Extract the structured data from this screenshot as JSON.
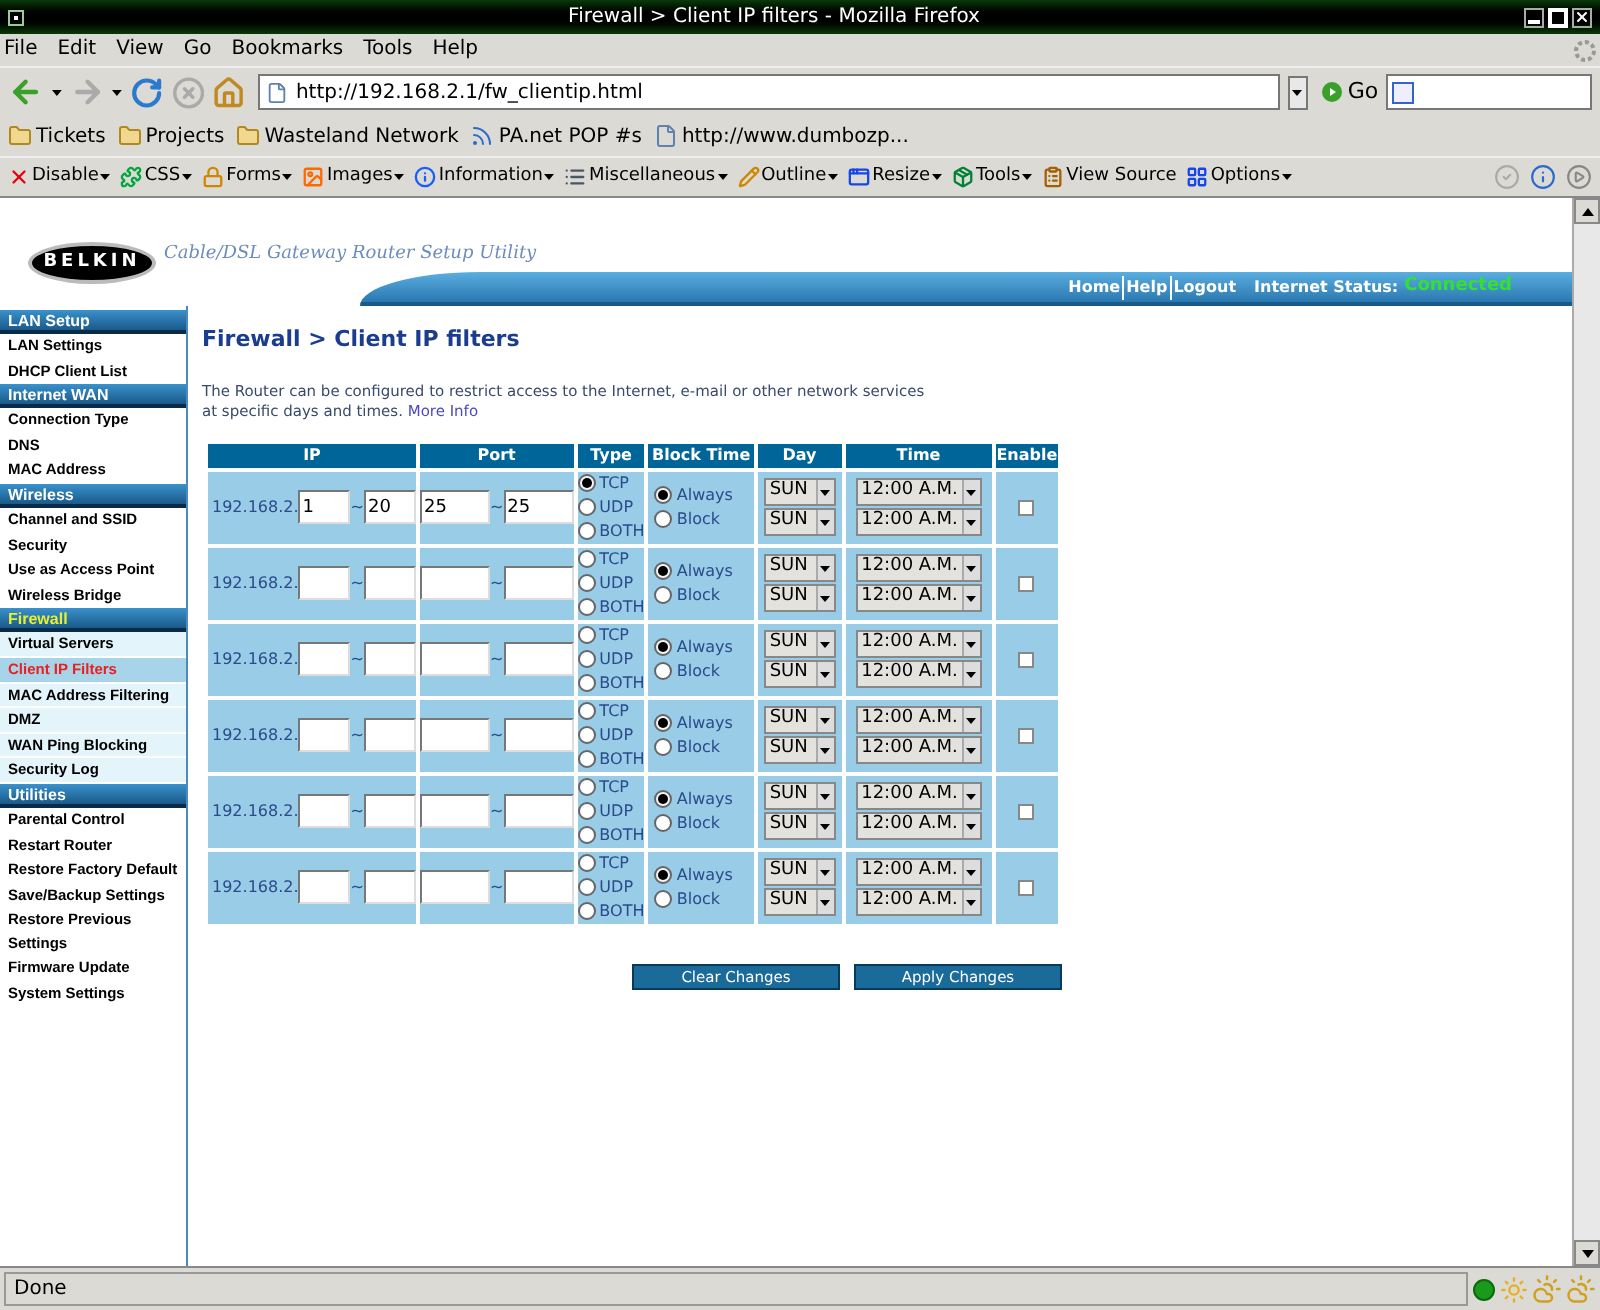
{
  "window": {
    "title": "Firewall > Client IP filters - Mozilla Firefox"
  },
  "menu": [
    "File",
    "Edit",
    "View",
    "Go",
    "Bookmarks",
    "Tools",
    "Help"
  ],
  "navigation": {
    "url": "http://192.168.2.1/fw_clientip.html",
    "go": "Go"
  },
  "bookmarks": [
    {
      "label": "Tickets",
      "kind": "folder"
    },
    {
      "label": "Projects",
      "kind": "folder"
    },
    {
      "label": "Wasteland Network",
      "kind": "folder"
    },
    {
      "label": "PA.net POP #s",
      "kind": "feed"
    },
    {
      "label": "http://www.dumbozp...",
      "kind": "page"
    }
  ],
  "dev_toolbar": [
    {
      "label": "Disable",
      "has_menu": true
    },
    {
      "label": "CSS",
      "has_menu": true
    },
    {
      "label": "Forms",
      "has_menu": true
    },
    {
      "label": "Images",
      "has_menu": true
    },
    {
      "label": "Information",
      "has_menu": true
    },
    {
      "label": "Miscellaneous",
      "has_menu": true
    },
    {
      "label": "Outline",
      "has_menu": true
    },
    {
      "label": "Resize",
      "has_menu": true
    },
    {
      "label": "Tools",
      "has_menu": true
    },
    {
      "label": "View Source",
      "has_menu": false
    },
    {
      "label": "Options",
      "has_menu": true
    }
  ],
  "page": {
    "logo": "BELKIN",
    "tagline": "Cable/DSL Gateway Router Setup Utility",
    "header_links": [
      "Home",
      "Help",
      "Logout"
    ],
    "status_label": "Internet Status:",
    "status_value": "Connected",
    "sidebar": [
      {
        "title": "LAN Setup",
        "selected": false,
        "items": [
          {
            "label": "LAN Settings",
            "selected": false
          },
          {
            "label": "DHCP Client List",
            "selected": false
          }
        ]
      },
      {
        "title": "Internet WAN",
        "selected": false,
        "items": [
          {
            "label": "Connection Type",
            "selected": false
          },
          {
            "label": "DNS",
            "selected": false
          },
          {
            "label": "MAC Address",
            "selected": false
          }
        ]
      },
      {
        "title": "Wireless",
        "selected": false,
        "items": [
          {
            "label": "Channel and SSID",
            "selected": false
          },
          {
            "label": "Security",
            "selected": false
          },
          {
            "label": "Use as Access Point",
            "selected": false
          },
          {
            "label": "Wireless Bridge",
            "selected": false
          }
        ]
      },
      {
        "title": "Firewall",
        "selected": true,
        "items": [
          {
            "label": "Virtual Servers",
            "selected": false
          },
          {
            "label": "Client IP Filters",
            "selected": true
          },
          {
            "label": "MAC Address Filtering",
            "selected": false
          },
          {
            "label": "DMZ",
            "selected": false
          },
          {
            "label": "WAN Ping Blocking",
            "selected": false
          },
          {
            "label": "Security Log",
            "selected": false
          }
        ]
      },
      {
        "title": "Utilities",
        "selected": false,
        "items": [
          {
            "label": "Parental Control",
            "selected": false
          },
          {
            "label": "Restart Router",
            "selected": false
          },
          {
            "label": "Restore Factory Default",
            "selected": false
          },
          {
            "label": "Save/Backup Settings",
            "selected": false
          },
          {
            "label": "Restore Previous Settings",
            "selected": false
          },
          {
            "label": "Firmware Update",
            "selected": false
          },
          {
            "label": "System Settings",
            "selected": false
          }
        ]
      }
    ],
    "heading": "Firewall > Client IP filters",
    "description": "The Router can be configured to restrict access to the Internet, e-mail or other network services at specific days and times.",
    "more_info": "More Info",
    "columns": [
      "IP",
      "Port",
      "Type",
      "Block Time",
      "Day",
      "Time",
      "Enable"
    ],
    "rows": [
      {
        "ip_prefix": "192.168.2.",
        "ip_from": "1",
        "ip_separator": "~",
        "ip_to": "20",
        "port_from": "25",
        "port_separator": "~",
        "port_to": "25",
        "type": [
          {
            "label": "TCP",
            "selected": true
          },
          {
            "label": "UDP",
            "selected": false
          },
          {
            "label": "BOTH",
            "selected": false
          }
        ],
        "block_time": [
          {
            "label": "Always",
            "selected": true
          },
          {
            "label": "Block",
            "selected": false
          }
        ],
        "day_from": "SUN",
        "day_to": "SUN",
        "time_from": "12:00 A.M.",
        "time_to": "12:00 A.M.",
        "enabled": false
      },
      {
        "ip_prefix": "192.168.2.",
        "ip_separator": "~",
        "port_separator": "~",
        "type": [
          {
            "label": "TCP",
            "selected": false
          },
          {
            "label": "UDP",
            "selected": false
          },
          {
            "label": "BOTH",
            "selected": false
          }
        ],
        "block_time": [
          {
            "label": "Always",
            "selected": true
          },
          {
            "label": "Block",
            "selected": false
          }
        ],
        "day_from": "SUN",
        "day_to": "SUN",
        "time_from": "12:00 A.M.",
        "time_to": "12:00 A.M.",
        "enabled": false
      },
      {
        "ip_prefix": "192.168.2.",
        "ip_separator": "~",
        "port_separator": "~",
        "type": [
          {
            "label": "TCP",
            "selected": false
          },
          {
            "label": "UDP",
            "selected": false
          },
          {
            "label": "BOTH",
            "selected": false
          }
        ],
        "block_time": [
          {
            "label": "Always",
            "selected": true
          },
          {
            "label": "Block",
            "selected": false
          }
        ],
        "day_from": "SUN",
        "day_to": "SUN",
        "time_from": "12:00 A.M.",
        "time_to": "12:00 A.M.",
        "enabled": false
      },
      {
        "ip_prefix": "192.168.2.",
        "ip_separator": "~",
        "port_separator": "~",
        "type": [
          {
            "label": "TCP",
            "selected": false
          },
          {
            "label": "UDP",
            "selected": false
          },
          {
            "label": "BOTH",
            "selected": false
          }
        ],
        "block_time": [
          {
            "label": "Always",
            "selected": true
          },
          {
            "label": "Block",
            "selected": false
          }
        ],
        "day_from": "SUN",
        "day_to": "SUN",
        "time_from": "12:00 A.M.",
        "time_to": "12:00 A.M.",
        "enabled": false
      },
      {
        "ip_prefix": "192.168.2.",
        "ip_separator": "~",
        "port_separator": "~",
        "type": [
          {
            "label": "TCP",
            "selected": false
          },
          {
            "label": "UDP",
            "selected": false
          },
          {
            "label": "BOTH",
            "selected": false
          }
        ],
        "block_time": [
          {
            "label": "Always",
            "selected": true
          },
          {
            "label": "Block",
            "selected": false
          }
        ],
        "day_from": "SUN",
        "day_to": "SUN",
        "time_from": "12:00 A.M.",
        "time_to": "12:00 A.M.",
        "enabled": false
      },
      {
        "ip_prefix": "192.168.2.",
        "ip_separator": "~",
        "port_separator": "~",
        "type": [
          {
            "label": "TCP",
            "selected": false
          },
          {
            "label": "UDP",
            "selected": false
          },
          {
            "label": "BOTH",
            "selected": false
          }
        ],
        "block_time": [
          {
            "label": "Always",
            "selected": true
          },
          {
            "label": "Block",
            "selected": false
          }
        ],
        "day_from": "SUN",
        "day_to": "SUN",
        "time_from": "12:00 A.M.",
        "time_to": "12:00 A.M.",
        "enabled": false
      }
    ],
    "buttons": [
      "Clear Changes",
      "Apply Changes"
    ]
  },
  "status_bar": {
    "text": "Done"
  }
}
